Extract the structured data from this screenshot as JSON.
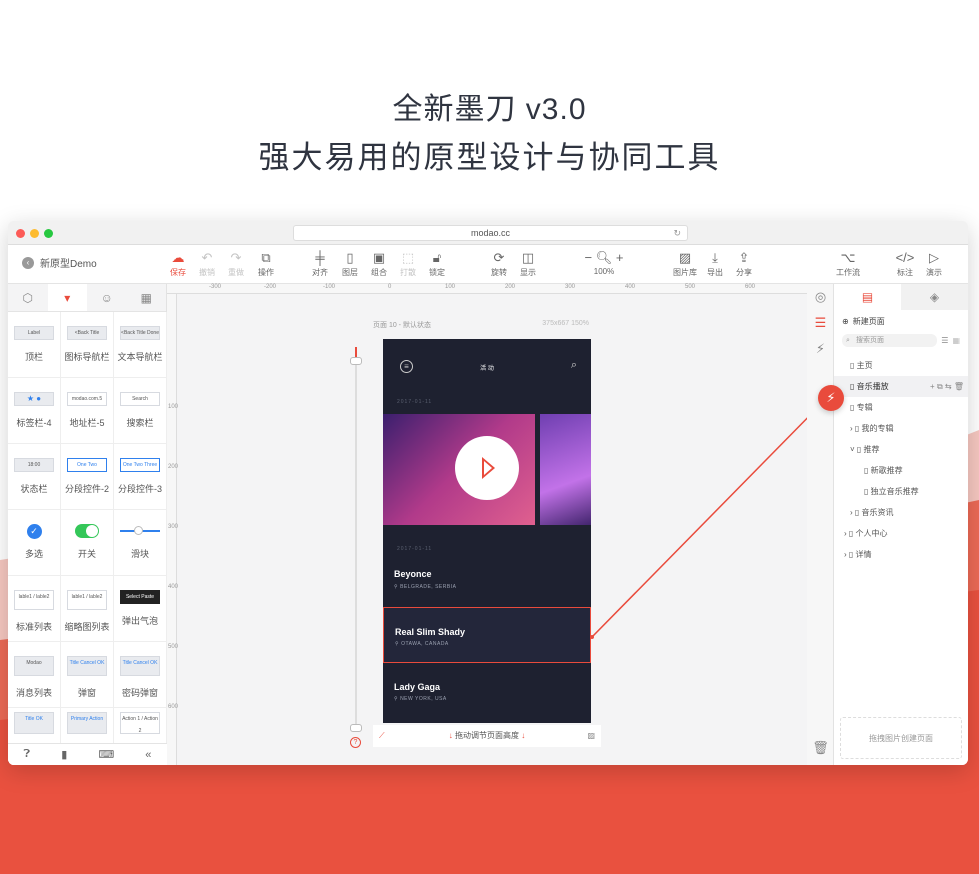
{
  "hero": {
    "line1": "全新墨刀 v3.0",
    "line2": "强大易用的原型设计与协同工具"
  },
  "browser": {
    "url": "modao.cc"
  },
  "toolbar": {
    "project_title": "新原型Demo",
    "buttons": [
      {
        "label": "保存",
        "icon": "upload-cloud"
      },
      {
        "label": "撤销",
        "icon": "undo"
      },
      {
        "label": "重做",
        "icon": "redo"
      },
      {
        "label": "操作",
        "icon": "copy"
      },
      {
        "label": "对齐",
        "icon": "align"
      },
      {
        "label": "图层",
        "icon": "layers"
      },
      {
        "label": "组合",
        "icon": "group"
      },
      {
        "label": "打散",
        "icon": "ungroup"
      },
      {
        "label": "锁定",
        "icon": "lock"
      },
      {
        "label": "旋转",
        "icon": "rotate"
      },
      {
        "label": "显示",
        "icon": "display"
      },
      {
        "label": "图片库",
        "icon": "image-library"
      },
      {
        "label": "导出",
        "icon": "export"
      },
      {
        "label": "分享",
        "icon": "share"
      },
      {
        "label": "工作流",
        "icon": "workflow"
      },
      {
        "label": "标注",
        "icon": "annotation"
      },
      {
        "label": "演示",
        "icon": "play"
      }
    ],
    "zoom": "100%"
  },
  "left_panel": {
    "widgets": [
      {
        "label": "顶栏",
        "thumb": "Label"
      },
      {
        "label": "图标导航栏",
        "thumb": "<Back  Title"
      },
      {
        "label": "文本导航栏",
        "thumb": "<Back  Title  Done"
      },
      {
        "label": "标签栏-4",
        "thumb": "★  ●"
      },
      {
        "label": "地址栏-5",
        "thumb": "modao.com.5"
      },
      {
        "label": "搜索栏",
        "thumb": "Search"
      },
      {
        "label": "状态栏",
        "thumb": "18:00"
      },
      {
        "label": "分段控件-2",
        "thumb": "One  Two"
      },
      {
        "label": "分段控件-3",
        "thumb": "One  Two  Three"
      },
      {
        "label": "多选",
        "thumb": ""
      },
      {
        "label": "开关",
        "thumb": ""
      },
      {
        "label": "滑块",
        "thumb": ""
      },
      {
        "label": "标准列表",
        "thumb": "lable1 / lable2"
      },
      {
        "label": "缩略图列表",
        "thumb": "lable1 / lable2"
      },
      {
        "label": "弹出气泡",
        "thumb": "Select  Paste"
      },
      {
        "label": "消息列表",
        "thumb": "Modao"
      },
      {
        "label": "弹窗",
        "thumb": "Title  Cancel  OK"
      },
      {
        "label": "密码弹窗",
        "thumb": "Title  Cancel  OK"
      },
      {
        "label": "",
        "thumb": "Title  OK"
      },
      {
        "label": "",
        "thumb": "Primary Action"
      },
      {
        "label": "",
        "thumb": "Action 1 / Action 2"
      }
    ]
  },
  "canvas": {
    "page_label": "页面 10 - 默认状态",
    "page_size": "375x667 150%",
    "ruler_h": [
      "-300",
      "-200",
      "-100",
      "0",
      "100",
      "200",
      "300",
      "400",
      "500",
      "600"
    ],
    "ruler_v": [
      "100",
      "200",
      "300",
      "400",
      "500",
      "600"
    ],
    "bottom_hint": "拖动调节页面高度",
    "phone": {
      "header_title": "活 动",
      "date1": "2017-01-11",
      "date2": "2017-01-11",
      "events": [
        {
          "artist": "Beyonce",
          "place": "BELGRADE, SERBIA"
        },
        {
          "artist": "Real Slim Shady",
          "place": "OTAWA, CANADA"
        },
        {
          "artist": "Lady Gaga",
          "place": "NEW YORK, USA"
        }
      ]
    }
  },
  "right_panel": {
    "new_page": "新建页面",
    "search_placeholder": "搜索页面",
    "tree": [
      {
        "label": "主页",
        "depth": 1
      },
      {
        "label": "音乐播放",
        "depth": 1,
        "selected": true
      },
      {
        "label": "专辑",
        "depth": 1
      },
      {
        "label": "我的专辑",
        "depth": 1
      },
      {
        "label": "推荐",
        "depth": 1
      },
      {
        "label": "新歌推荐",
        "depth": 2
      },
      {
        "label": "独立音乐推荐",
        "depth": 2
      },
      {
        "label": "音乐资讯",
        "depth": 1
      },
      {
        "label": "个人中心",
        "depth": 0
      },
      {
        "label": "详情",
        "depth": 0
      }
    ],
    "drop_hint": "拖拽图片创建页面"
  },
  "colors": {
    "accent": "#e94b3c",
    "phone_bg": "#1e2130",
    "wave": "#e9513f"
  }
}
